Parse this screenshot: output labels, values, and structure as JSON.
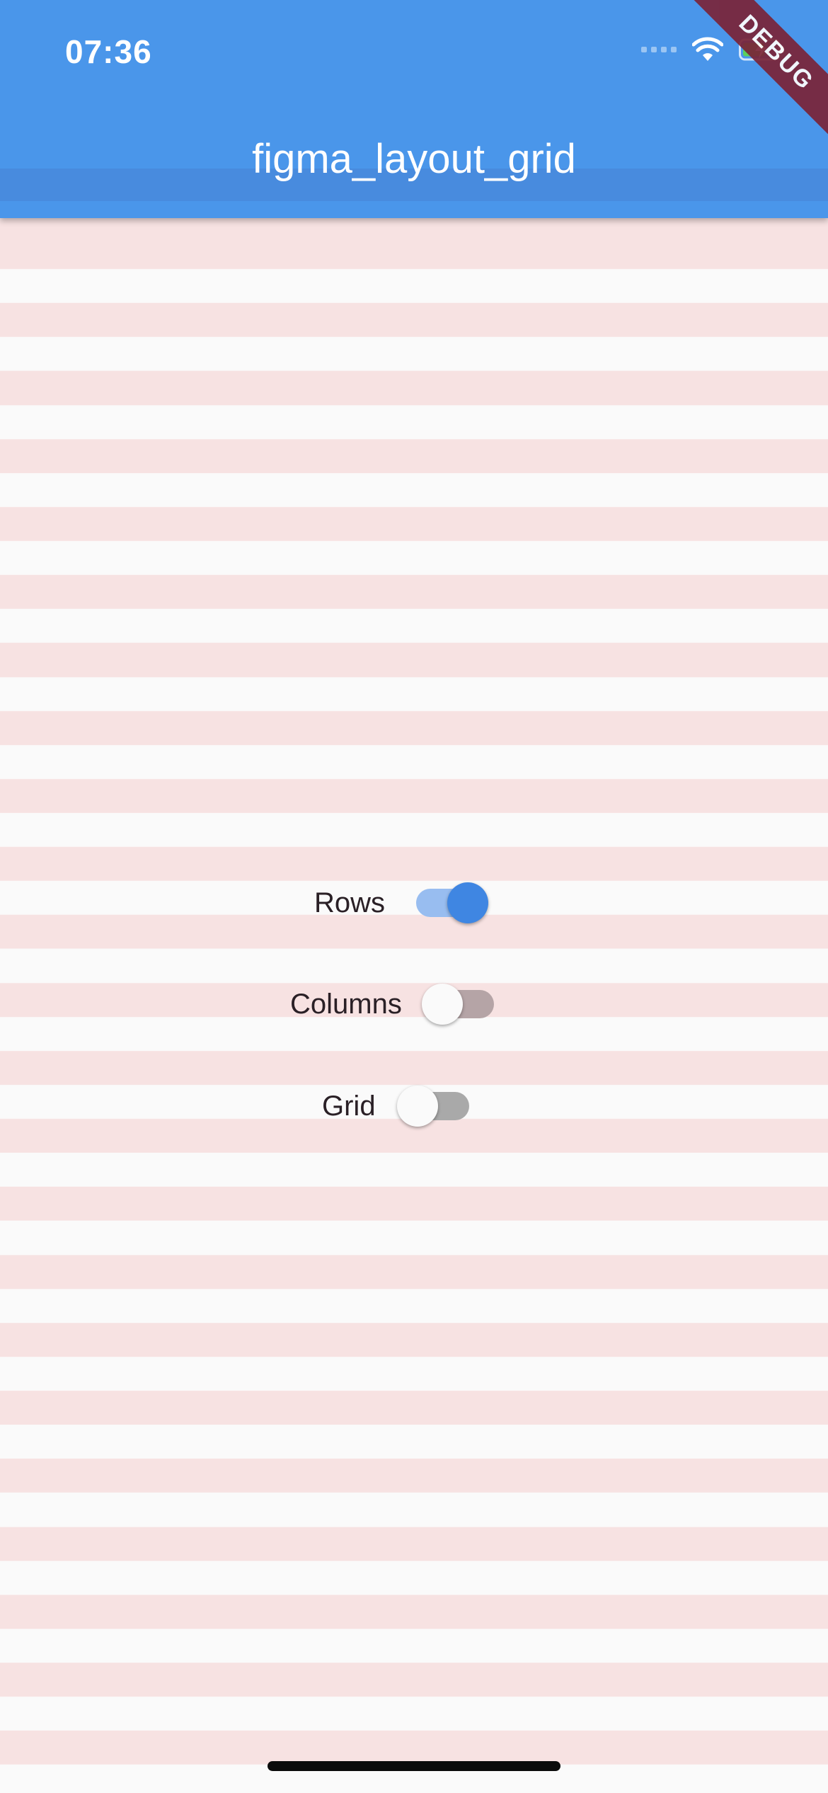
{
  "status_bar": {
    "time": "07:36",
    "icons": [
      "signal-icon",
      "wifi-icon",
      "battery-charging-icon"
    ]
  },
  "app_bar": {
    "title": "figma_layout_grid",
    "color": "#4a96ea"
  },
  "debug_banner": "DEBUG",
  "controls": [
    {
      "label": "Rows",
      "enabled": true
    },
    {
      "label": "Columns",
      "enabled": false
    },
    {
      "label": "Grid",
      "enabled": false
    }
  ],
  "colors": {
    "row_stripe": "#f7e2e2",
    "background": "#fafafa",
    "switch_active": "#3f86e2"
  }
}
